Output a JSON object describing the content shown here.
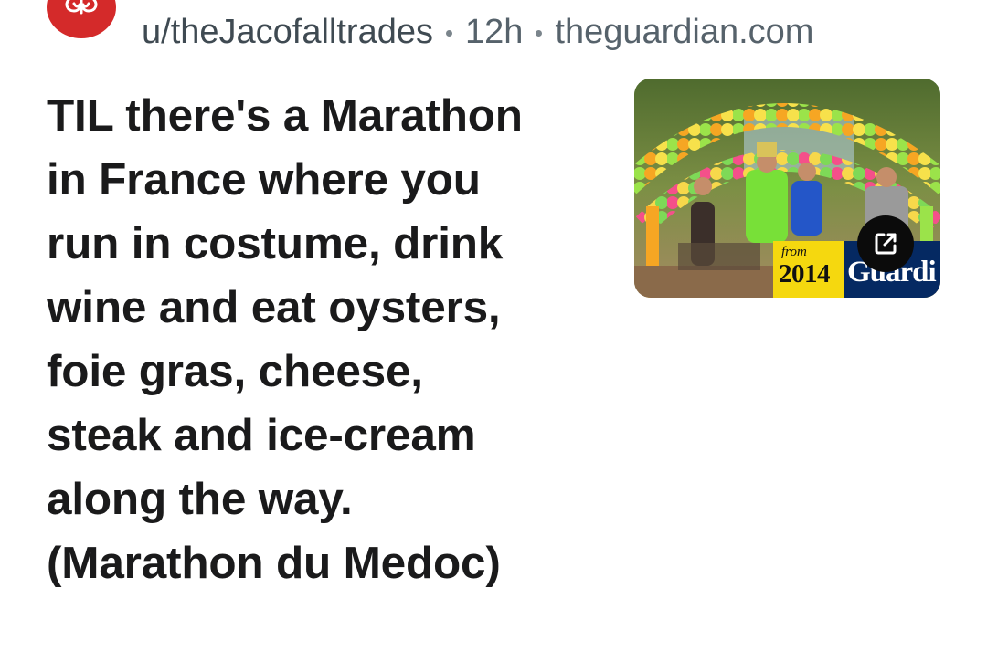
{
  "post": {
    "username": "u/theJacofalltrades",
    "age": "12h",
    "domain": "theguardian.com",
    "title": "TIL there's a Marathon in France where you run in costume, drink wine and eat oysters, foie gras, cheese, steak and ice-cream along the way. (Marathon du Medoc)"
  },
  "thumbnail": {
    "from_label": "from",
    "year": "2014",
    "brand": "Guardi"
  },
  "colors": {
    "avatar_bg": "#d42a2a",
    "meta_text": "#56626b",
    "title_text": "#1a1a1b",
    "year_badge": "#f5d80f",
    "brand_badge": "#052962"
  },
  "icons": {
    "avatar": "brain-icon",
    "external_link": "external-link-icon"
  }
}
